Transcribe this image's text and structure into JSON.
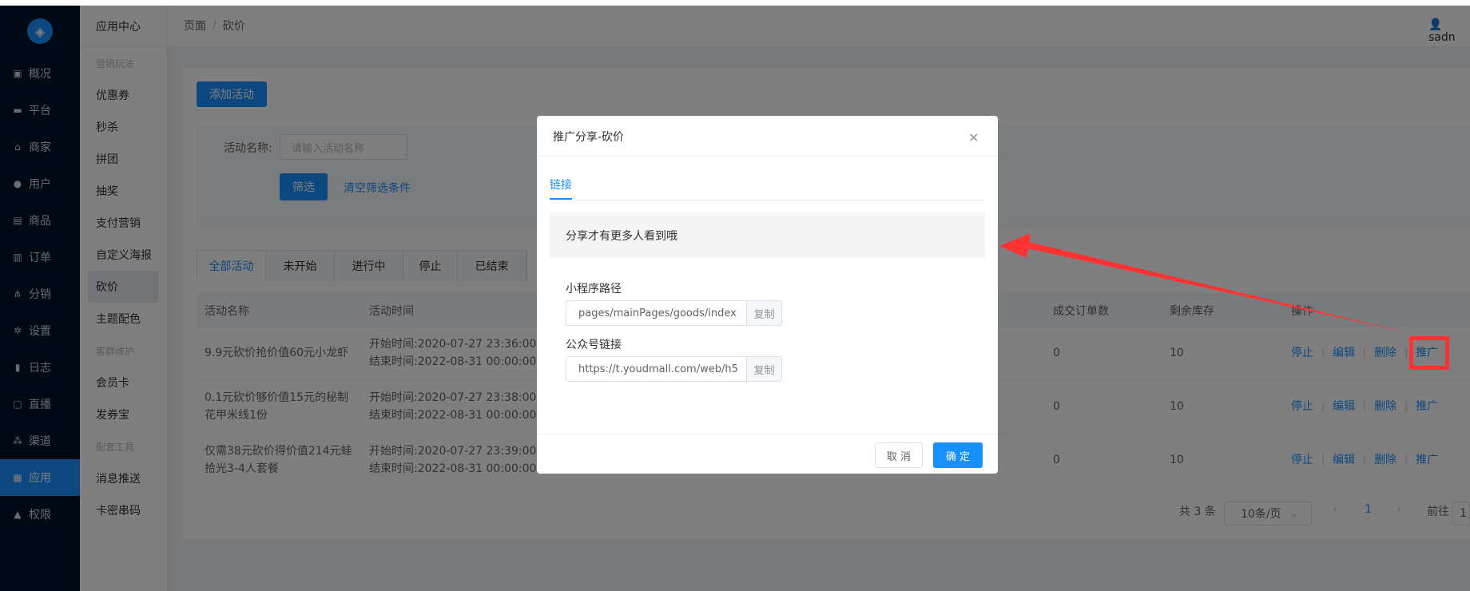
{
  "sidebar": {
    "items": [
      {
        "label": "概况",
        "icon": "dashboard-icon"
      },
      {
        "label": "平台",
        "icon": "monitor-icon"
      },
      {
        "label": "商家",
        "icon": "store-icon"
      },
      {
        "label": "用户",
        "icon": "user-icon"
      },
      {
        "label": "商品",
        "icon": "goods-icon"
      },
      {
        "label": "订单",
        "icon": "order-icon"
      },
      {
        "label": "分销",
        "icon": "distribution-icon"
      },
      {
        "label": "设置",
        "icon": "gear-icon"
      },
      {
        "label": "日志",
        "icon": "log-icon"
      },
      {
        "label": "直播",
        "icon": "live-icon"
      },
      {
        "label": "渠道",
        "icon": "channel-icon"
      },
      {
        "label": "应用",
        "icon": "apps-icon"
      },
      {
        "label": "权限",
        "icon": "lock-icon"
      }
    ],
    "active": "应用"
  },
  "subnav": {
    "title": "应用中心",
    "groups": [
      {
        "title": "营销玩法",
        "items": [
          "优惠券",
          "秒杀",
          "拼团",
          "抽奖",
          "支付营销",
          "自定义海报",
          "砍价",
          "主题配色"
        ]
      },
      {
        "title": "客群维护",
        "items": [
          "会员卡",
          "发券宝"
        ]
      },
      {
        "title": "配套工具",
        "items": [
          "消息推送",
          "卡密串码"
        ]
      }
    ],
    "active": "砍价"
  },
  "header": {
    "breadcrumb": [
      "页面",
      "砍价"
    ],
    "separator": "/",
    "user": "sadn"
  },
  "toolbar": {
    "add_label": "添加活动"
  },
  "filter": {
    "name_label": "活动名称:",
    "name_placeholder": "请输入活动名称",
    "filter_btn": "筛选",
    "clear_link": "清空筛选条件"
  },
  "tabs": [
    "全部活动",
    "未开始",
    "进行中",
    "停止",
    "已结束"
  ],
  "table": {
    "columns": [
      "活动名称",
      "活动时间",
      "成交订单数",
      "剩余库存",
      "操作"
    ],
    "rows": [
      {
        "name": "9.9元砍价抢价值60元小龙虾",
        "start": "开始时间:2020-07-27 23:36:00",
        "end": "结束时间:2022-08-31 00:00:00",
        "orders": "0",
        "stock": "10"
      },
      {
        "name": "0.1元砍价够价值15元的秘制花甲米线1份",
        "start": "开始时间:2020-07-27 23:38:00",
        "end": "结束时间:2022-08-31 00:00:00",
        "orders": "0",
        "stock": "10"
      },
      {
        "name": "仅需38元砍价得价值214元蛙拾光3-4人套餐",
        "start": "开始时间:2020-07-27 23:39:00",
        "end": "结束时间:2022-08-31 00:00:00",
        "orders": "0",
        "stock": "10"
      }
    ],
    "ops": [
      "停止",
      "编辑",
      "删除",
      "推广"
    ]
  },
  "pagination": {
    "total": "共 3 条",
    "page_size": "10条/页",
    "current": "1",
    "goto": "前往",
    "goto_value": "1"
  },
  "dialog": {
    "title": "推广分享-砍价",
    "tab": "链接",
    "tip": "分享才有更多人看到哦",
    "mini_label": "小程序路径",
    "mini_value": "pages/mainPages/goods/index",
    "mp_label": "公众号链接",
    "mp_value": "https://t.youdmall.com/web/h5",
    "copy": "复制",
    "cancel": "取 消",
    "confirm": "确 定"
  },
  "colors": {
    "primary": "#1890ff",
    "sidebar": "#001529",
    "annotation": "#ff3333"
  }
}
